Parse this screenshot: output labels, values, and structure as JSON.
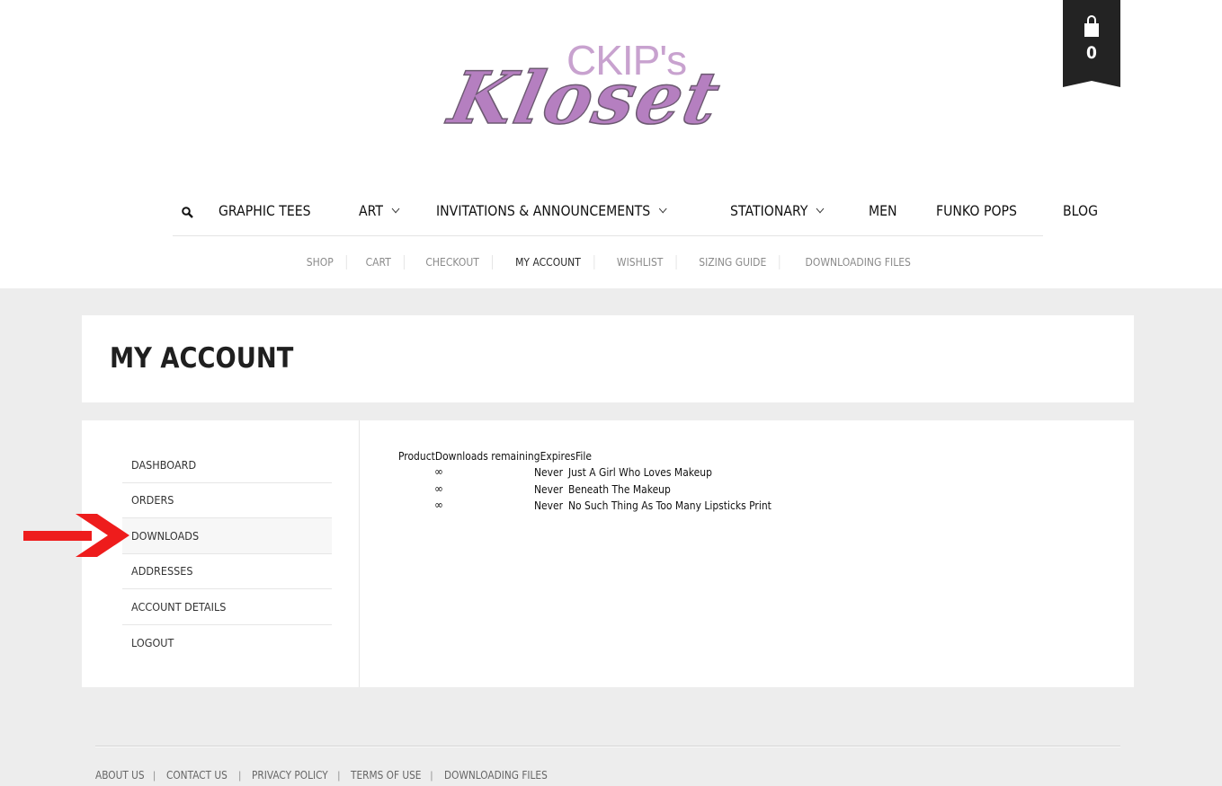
{
  "brand": {
    "logo_top": "CKIP's",
    "logo_bottom": "Kloset"
  },
  "cart": {
    "count": "0",
    "icon": "shopping-bag-icon"
  },
  "main_nav": {
    "search_icon": "search-icon",
    "items": [
      {
        "label": "GRAPHIC TEES",
        "has_dropdown": false
      },
      {
        "label": "ART",
        "has_dropdown": true
      },
      {
        "label": "INVITATIONS & ANNOUNCEMENTS",
        "has_dropdown": true
      },
      {
        "label": "STATIONARY",
        "has_dropdown": true
      },
      {
        "label": "MEN",
        "has_dropdown": false
      },
      {
        "label": "FUNKO POPS",
        "has_dropdown": false
      },
      {
        "label": "BLOG",
        "has_dropdown": false
      }
    ]
  },
  "sub_nav": {
    "items": [
      "SHOP",
      "CART",
      "CHECKOUT",
      "MY ACCOUNT",
      "WISHLIST",
      "SIZING GUIDE",
      "DOWNLOADING FILES"
    ],
    "active": "MY ACCOUNT"
  },
  "page": {
    "title": "MY ACCOUNT"
  },
  "account_menu": {
    "items": [
      "DASHBOARD",
      "ORDERS",
      "DOWNLOADS",
      "ADDRESSES",
      "ACCOUNT DETAILS",
      "LOGOUT"
    ],
    "active": "DOWNLOADS"
  },
  "downloads": {
    "headers": [
      "Product",
      "Downloads remaining",
      "Expires",
      "File"
    ],
    "rows": [
      {
        "remaining": "∞",
        "expires": "Never",
        "file": "Just A Girl Who Loves Makeup"
      },
      {
        "remaining": "∞",
        "expires": "Never",
        "file": "Beneath The Makeup"
      },
      {
        "remaining": "∞",
        "expires": "Never",
        "file": "No Such Thing As Too Many Lipsticks Print"
      }
    ]
  },
  "footer": {
    "links": [
      "ABOUT US",
      "CONTACT US",
      "PRIVACY POLICY",
      "TERMS OF USE",
      "DOWNLOADING FILES"
    ],
    "separator": "|"
  },
  "colors": {
    "accent": "#b57fc0",
    "arrow": "#ee1c1c",
    "cart_bg": "#232323",
    "page_bg": "#ededed"
  }
}
